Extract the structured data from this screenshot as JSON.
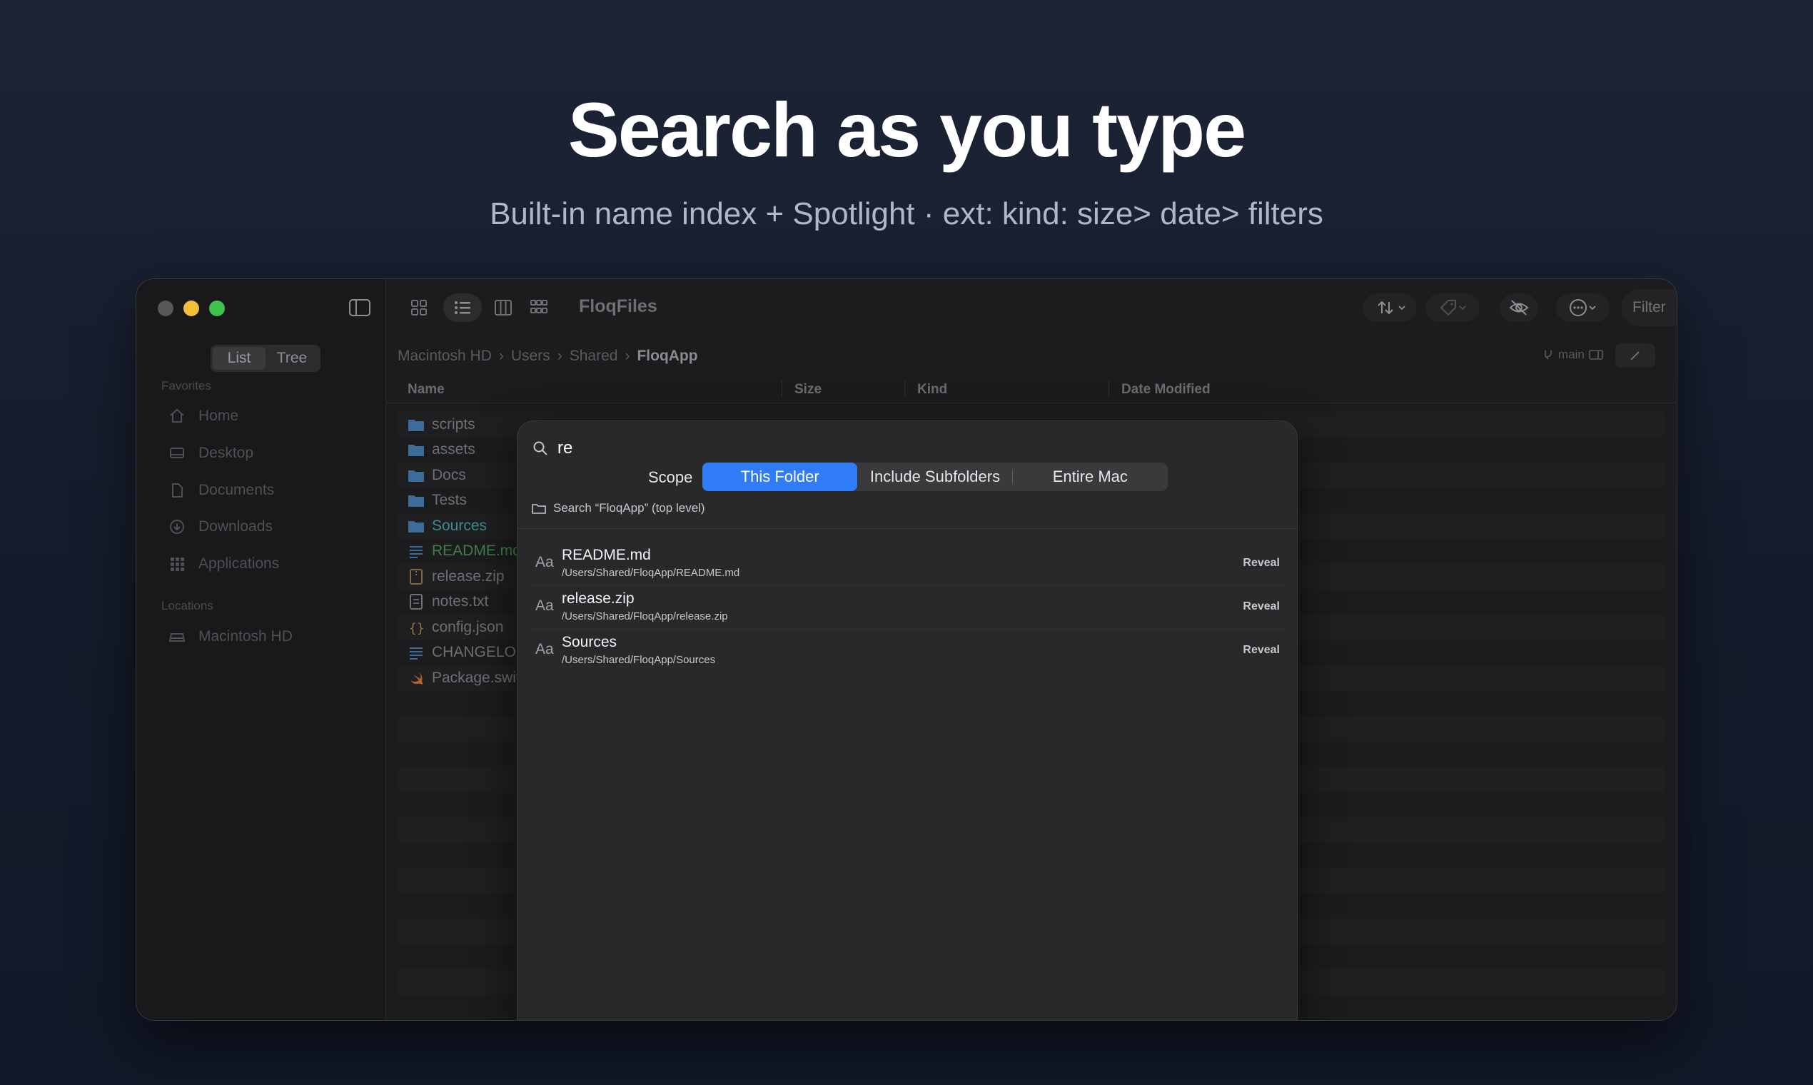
{
  "hero": {
    "title": "Search as you type",
    "subtitle": "Built-in name index + Spotlight · ext:  kind:  size>  date>  filters"
  },
  "sidebar": {
    "view_modes": [
      "List",
      "Tree"
    ],
    "favorites_header": "Favorites",
    "favorites": [
      {
        "label": "Home",
        "icon": "house-icon"
      },
      {
        "label": "Desktop",
        "icon": "desktop-icon"
      },
      {
        "label": "Documents",
        "icon": "document-icon"
      },
      {
        "label": "Downloads",
        "icon": "download-icon"
      },
      {
        "label": "Applications",
        "icon": "applications-grid-icon"
      }
    ],
    "locations_header": "Locations",
    "locations": [
      {
        "label": "Macintosh HD",
        "icon": "drive-icon"
      }
    ]
  },
  "toolbar": {
    "app_title": "FloqFiles",
    "filter_placeholder": "Filter"
  },
  "breadcrumb": {
    "items": [
      "Macintosh HD",
      "Users",
      "Shared"
    ],
    "current": "FloqApp"
  },
  "git": {
    "branch": "main"
  },
  "columns": {
    "name": "Name",
    "size": "Size",
    "kind": "Kind",
    "date": "Date Modified"
  },
  "files": [
    {
      "name": "scripts",
      "icon": "folder-icon"
    },
    {
      "name": "assets",
      "icon": "folder-icon"
    },
    {
      "name": "Docs",
      "icon": "folder-icon"
    },
    {
      "name": "Tests",
      "icon": "folder-icon"
    },
    {
      "name": "Sources",
      "icon": "folder-icon"
    },
    {
      "name": "README.md",
      "icon": "markdown-icon"
    },
    {
      "name": "release.zip",
      "icon": "zip-icon"
    },
    {
      "name": "notes.txt",
      "icon": "text-file-icon"
    },
    {
      "name": "config.json",
      "icon": "json-icon"
    },
    {
      "name": "CHANGELOG.md",
      "icon": "markdown-icon"
    },
    {
      "name": "Package.swift",
      "icon": "swift-icon"
    }
  ],
  "search": {
    "query": "re",
    "scope_label": "Scope",
    "scopes": [
      "This Folder",
      "Include Subfolders",
      "Entire Mac"
    ],
    "active_scope": "This Folder",
    "hint": "Search “FloqApp” (top level)",
    "results": [
      {
        "icon_text": "Aa",
        "name": "README.md",
        "path": "/Users/Shared/FloqApp/README.md",
        "action": "Reveal"
      },
      {
        "icon_text": "Aa",
        "name": "release.zip",
        "path": "/Users/Shared/FloqApp/release.zip",
        "action": "Reveal"
      },
      {
        "icon_text": "Aa",
        "name": "Sources",
        "path": "/Users/Shared/FloqApp/Sources",
        "action": "Reveal"
      }
    ]
  },
  "colors": {
    "accent": "#2f7cf6",
    "traffic_close": "#57575a",
    "traffic_minimize": "#f4bd3b",
    "traffic_maximize": "#3fc34f"
  }
}
